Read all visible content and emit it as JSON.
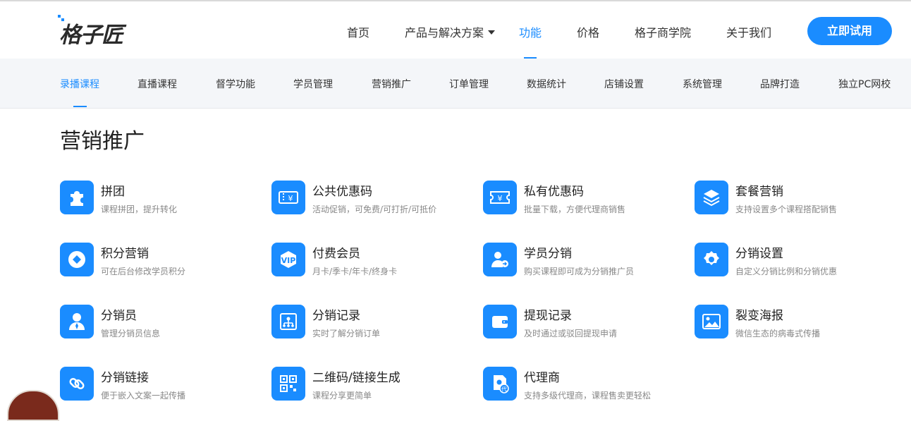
{
  "brand": {
    "logo_text": "格子匠",
    "accent": "#1a8cff"
  },
  "nav": {
    "items": [
      {
        "label": "首页"
      },
      {
        "label": "产品与解决方案",
        "has_dropdown": true
      },
      {
        "label": "功能",
        "active": true
      },
      {
        "label": "价格"
      },
      {
        "label": "格子商学院"
      },
      {
        "label": "关于我们"
      }
    ],
    "cta_label": "立即试用"
  },
  "subnav": {
    "items": [
      {
        "label": "录播课程",
        "active": true
      },
      {
        "label": "直播课程"
      },
      {
        "label": "督学功能"
      },
      {
        "label": "学员管理"
      },
      {
        "label": "营销推广"
      },
      {
        "label": "订单管理"
      },
      {
        "label": "数据统计"
      },
      {
        "label": "店铺设置"
      },
      {
        "label": "系统管理"
      },
      {
        "label": "品牌打造"
      },
      {
        "label": "独立PC网校"
      }
    ]
  },
  "section": {
    "title": "营销推广",
    "features": [
      {
        "title": "拼团",
        "desc": "课程拼团，提升转化",
        "icon": "puzzle-icon"
      },
      {
        "title": "公共优惠码",
        "desc": "活动促销，可免费/可打折/可抵价",
        "icon": "coupon-icon"
      },
      {
        "title": "私有优惠码",
        "desc": "批量下载，方便代理商销售",
        "icon": "ticket-yen-icon"
      },
      {
        "title": "套餐营销",
        "desc": "支持设置多个课程搭配销售",
        "icon": "layers-icon"
      },
      {
        "title": "积分营销",
        "desc": "可在后台修改学员积分",
        "icon": "points-icon"
      },
      {
        "title": "付费会员",
        "desc": "月卡/季卡/年卡/终身卡",
        "icon": "vip-icon"
      },
      {
        "title": "学员分销",
        "desc": "购买课程即可成为分销推广员",
        "icon": "user-share-icon"
      },
      {
        "title": "分销设置",
        "desc": "自定义分销比例和分销优惠",
        "icon": "gear-icon"
      },
      {
        "title": "分销员",
        "desc": "管理分销员信息",
        "icon": "user-icon"
      },
      {
        "title": "分销记录",
        "desc": "实时了解分销订单",
        "icon": "org-chart-icon"
      },
      {
        "title": "提现记录",
        "desc": "及时通过或驳回提现申请",
        "icon": "wallet-icon"
      },
      {
        "title": "裂变海报",
        "desc": "微信生态的病毒式传播",
        "icon": "image-icon"
      },
      {
        "title": "分销链接",
        "desc": "便于嵌入文案一起传播",
        "icon": "link-icon"
      },
      {
        "title": "二维码/链接生成",
        "desc": "课程分享更简单",
        "icon": "qrcode-icon"
      },
      {
        "title": "代理商",
        "desc": "支持多级代理商，课程售卖更轻松",
        "icon": "agent-icon"
      }
    ]
  }
}
